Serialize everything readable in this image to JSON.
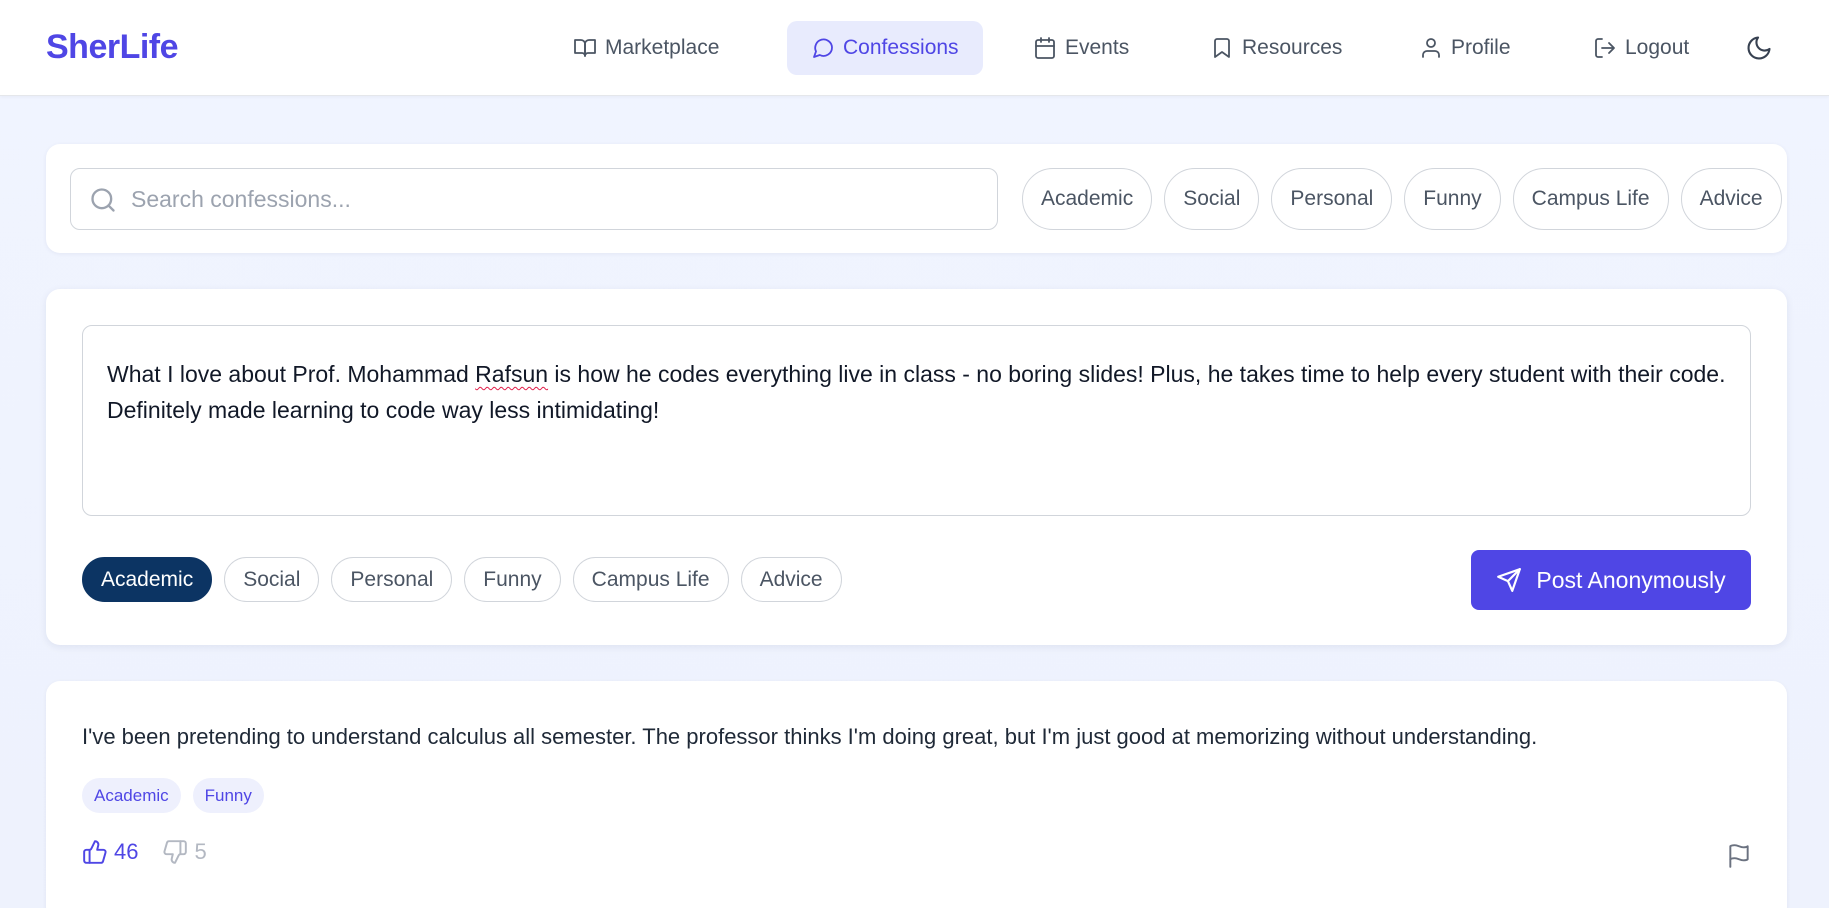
{
  "header": {
    "brand": "SherLife",
    "nav": [
      {
        "label": "Marketplace",
        "icon": "book-open-icon"
      },
      {
        "label": "Confessions",
        "icon": "message-circle-icon",
        "active": true
      },
      {
        "label": "Events",
        "icon": "calendar-icon"
      },
      {
        "label": "Resources",
        "icon": "bookmark-icon"
      },
      {
        "label": "Profile",
        "icon": "user-icon"
      },
      {
        "label": "Logout",
        "icon": "logout-icon"
      }
    ],
    "theme_toggle_icon": "moon-icon"
  },
  "search": {
    "placeholder": "Search confessions...",
    "value": "",
    "filters": [
      "Academic",
      "Social",
      "Personal",
      "Funny",
      "Campus Life",
      "Advice"
    ]
  },
  "compose": {
    "text_parts": {
      "before": "What I love about Prof.  Mohammad ",
      "misspelled": "Rafsun",
      "after": " is how he codes everything live in class - no boring slides! Plus, he takes time to help every student with their code. Definitely made learning to code way less intimidating!"
    },
    "categories": [
      "Academic",
      "Social",
      "Personal",
      "Funny",
      "Campus Life",
      "Advice"
    ],
    "selected_category": "Academic",
    "post_label": "Post Anonymously"
  },
  "confessions": [
    {
      "text": "I've been pretending to understand calculus all semester. The professor thinks I'm doing great, but I'm just good at memorizing without understanding.",
      "tags": [
        "Academic",
        "Funny"
      ],
      "upvotes": "46",
      "downvotes": "5"
    }
  ],
  "colors": {
    "brand": "#4f46e5",
    "selected_chip": "#0c3463",
    "active_nav_bg": "#e8ebfd",
    "tag_bg": "#eef0fd"
  }
}
